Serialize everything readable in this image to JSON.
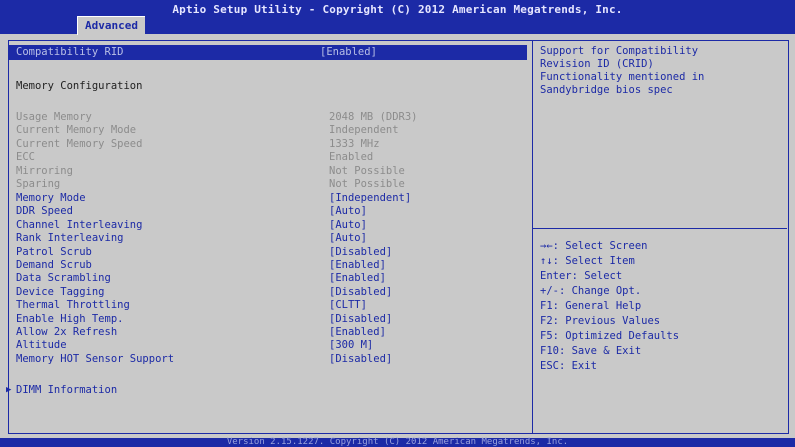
{
  "header": {
    "title": "Aptio Setup Utility - Copyright (C) 2012 American Megatrends, Inc.",
    "tab": "Advanced"
  },
  "selected": {
    "label": "Compatibility RID",
    "value": "[Enabled]"
  },
  "section_title": "Memory Configuration",
  "info_rows": [
    {
      "label": "Usage Memory",
      "value": "2048 MB (DDR3)"
    },
    {
      "label": "Current Memory Mode",
      "value": "Independent"
    },
    {
      "label": "Current Memory Speed",
      "value": "1333 MHz"
    },
    {
      "label": "ECC",
      "value": "Enabled"
    },
    {
      "label": "Mirroring",
      "value": "Not Possible"
    },
    {
      "label": "Sparing",
      "value": "Not Possible"
    }
  ],
  "setting_rows": [
    {
      "label": "Memory Mode",
      "value": "[Independent]"
    },
    {
      "label": "DDR Speed",
      "value": "[Auto]"
    },
    {
      "label": "Channel Interleaving",
      "value": "[Auto]"
    },
    {
      "label": "Rank Interleaving",
      "value": "[Auto]"
    },
    {
      "label": "Patrol Scrub",
      "value": "[Disabled]"
    },
    {
      "label": "Demand Scrub",
      "value": "[Enabled]"
    },
    {
      "label": "Data Scrambling",
      "value": "[Enabled]"
    },
    {
      "label": "Device Tagging",
      "value": "[Disabled]"
    },
    {
      "label": "Thermal Throttling",
      "value": "[CLTT]"
    },
    {
      "label": "Enable High Temp.",
      "value": "[Disabled]"
    },
    {
      "label": "Allow 2x Refresh",
      "value": "[Enabled]"
    },
    {
      "label": "Altitude",
      "value": "[300 M]"
    },
    {
      "label": "Memory HOT Sensor Support",
      "value": "[Disabled]"
    }
  ],
  "submenu": {
    "label": "DIMM Information"
  },
  "help": {
    "text": "Support for Compatibility\nRevision ID (CRID)\nFunctionality mentioned in\nSandybridge bios spec",
    "keys": [
      "→←: Select Screen",
      "↑↓: Select Item",
      "Enter: Select",
      "+/-: Change Opt.",
      "F1: General Help",
      "F2: Previous Values",
      "F5: Optimized Defaults",
      "F10: Save & Exit",
      "ESC: Exit"
    ]
  },
  "footer": "Version 2.15.1227. Copyright (C) 2012 American Megatrends, Inc."
}
